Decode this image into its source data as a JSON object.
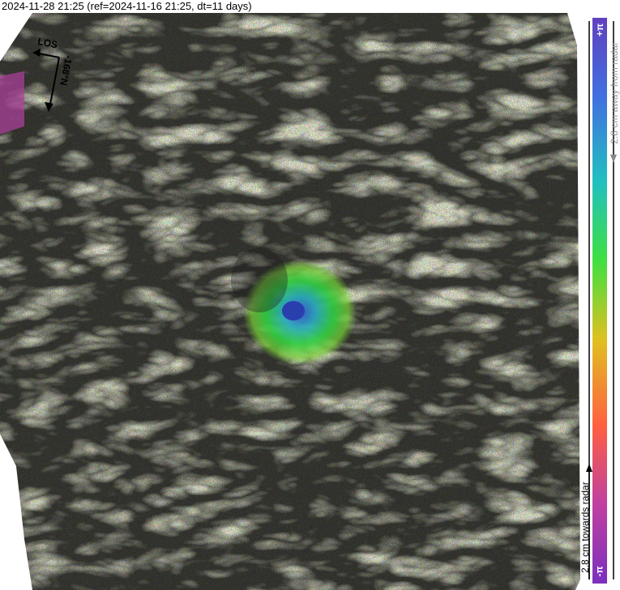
{
  "header": {
    "title": "2024-11-28 21:25 (ref=2024-11-16 21:25, dt=11 days)"
  },
  "los_indicator": {
    "los_label": "LOS",
    "heading_label": "-168°N"
  },
  "colorbar": {
    "top_label": "+π",
    "bottom_label": "-π",
    "away_label": "2.8 cm away from radar",
    "towards_label": "2.8 cm towards radar",
    "colors": [
      "#7b2fbf",
      "#c040a0",
      "#ff6040",
      "#e0c020",
      "#40e040",
      "#20c0c0",
      "#4070e0",
      "#6040c0"
    ]
  },
  "map": {
    "type": "interferogram-phase",
    "background": "#3a3a3a"
  }
}
